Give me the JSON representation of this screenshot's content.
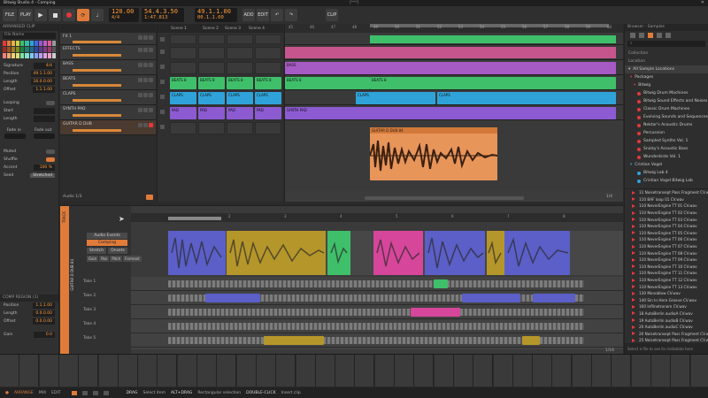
{
  "app_title": "Bitwig Studio 4 - Comping",
  "window_title": "[***]",
  "toolbar": {
    "file": "FILE",
    "play": "PLAY",
    "tempo": "120.00",
    "sig": "4/4",
    "pos1": "54.4.3.50",
    "pos2": "1:47.813",
    "pos3": "49.1.1.00",
    "pos4": "00.1.1.00",
    "add": "ADD",
    "edit": "EDIT",
    "clip": "CLIP"
  },
  "inspector": {
    "title": "ARRANGED CLIP",
    "file": "File Name",
    "rows": [
      {
        "label": "Signature",
        "value": "4/4"
      },
      {
        "label": "Position",
        "value": "49.1.1.00"
      },
      {
        "label": "Length",
        "value": "16.0.0.00"
      },
      {
        "label": "Offset",
        "value": "1.1.1.00"
      }
    ],
    "looping": "Looping",
    "start": "Start",
    "length": "Length",
    "fadein": "Fade in",
    "fadeout": "Fade out",
    "muted": "Muted",
    "shuffle": "Shuffle",
    "accent": "Accent",
    "accent_val": "100 %",
    "seed": "Seed",
    "stretched": "Stretched",
    "comp_title": "COMP REGION (1)",
    "comp_rows": [
      {
        "label": "Position",
        "value": "1.1.1.00"
      },
      {
        "label": "Length",
        "value": "0.0.0.00"
      },
      {
        "label": "Offset",
        "value": "0.0.0.00"
      },
      {
        "label": "Gain",
        "value": "0.0"
      }
    ]
  },
  "tracks": [
    {
      "name": "FX 1",
      "color": "#d66a6a"
    },
    {
      "name": "EFFECTS",
      "color": "#888"
    },
    {
      "name": "BASS",
      "color": "#a65ac4"
    },
    {
      "name": "BEATS",
      "color": "#3fbf6a"
    },
    {
      "name": "CLAPS",
      "color": "#2fa3d9"
    },
    {
      "name": "SYNTH PAD",
      "color": "#8c5ad1"
    },
    {
      "name": "GUITAR D DUB",
      "color": "#e07b3a"
    }
  ],
  "scenes": [
    "Scene 1",
    "Scene 2",
    "Scene 3",
    "Scene 4"
  ],
  "launcher_clips": [
    {
      "row": 3,
      "col": 0,
      "label": "BEATS 8",
      "color": "#3fbf6a"
    },
    {
      "row": 3,
      "col": 1,
      "label": "BEATS 8",
      "color": "#3fbf6a"
    },
    {
      "row": 3,
      "col": 2,
      "label": "BEATS 8",
      "color": "#3fbf6a"
    },
    {
      "row": 3,
      "col": 3,
      "label": "BEATS 8",
      "color": "#3fbf6a"
    },
    {
      "row": 4,
      "col": 0,
      "label": "CLAPS",
      "color": "#2fa3d9"
    },
    {
      "row": 4,
      "col": 1,
      "label": "CLAPS",
      "color": "#2fa3d9"
    },
    {
      "row": 4,
      "col": 2,
      "label": "CLAPS",
      "color": "#2fa3d9"
    },
    {
      "row": 4,
      "col": 3,
      "label": "CLAPS",
      "color": "#2fa3d9"
    },
    {
      "row": 5,
      "col": 0,
      "label": "PAD",
      "color": "#8c5ad1"
    },
    {
      "row": 5,
      "col": 1,
      "label": "PAD",
      "color": "#8c5ad1"
    },
    {
      "row": 5,
      "col": 2,
      "label": "PAD",
      "color": "#8c5ad1"
    },
    {
      "row": 5,
      "col": 3,
      "label": "PAD",
      "color": "#8c5ad1"
    }
  ],
  "ruler": [
    "45",
    "46",
    "47",
    "48",
    "49",
    "50",
    "51",
    "52",
    "53",
    "54",
    "55",
    "56",
    "57",
    "58",
    "59",
    "60",
    "61",
    "62"
  ],
  "arr_labels": {
    "bass": "BASS",
    "beats": "BEATS 8",
    "claps": "CLAPS",
    "pad": "SYNTH PAD",
    "guitar": "GUITAR D DUB 84"
  },
  "audio_label": "Audio 1/3",
  "zoom": "1/4",
  "browser": {
    "title": "Browser - Samples",
    "collection": "Collection",
    "location": "Location",
    "all": "All Sample Locations",
    "packages": "Packages",
    "bitwig": "Bitwig",
    "items": [
      "Bitwig Drum Machines",
      "Bitwig Sound Effects and Noises",
      "Classic Drum Machines",
      "Evolving Sounds and Sequences",
      "Nektar's Acoustic Drums",
      "Percussion",
      "Sampled Synths Vol. 1",
      "Snicky's Acoustic Bass",
      "Wunderkiste Vol. 1"
    ],
    "user": "Cristian Vogel",
    "user_items": [
      "Bitwig Lab 4",
      "Cristian Vogel Bitwig Lab"
    ],
    "files": [
      "11 Noisetransept Pass Fragment CV.wav",
      "110 BAF loop 01 CV.wav",
      "110 NeverEngine TT 01 CV.wav",
      "110 NeverEngine TT 02 CV.wav",
      "110 NeverEngine TT 03 CV.wav",
      "110 NeverEngine TT 04 CV.wav",
      "110 NeverEngine TT 05 CV.wav",
      "110 NeverEngine TT 06 CV.wav",
      "110 NeverEngine TT 07 CV.wav",
      "110 NeverEngine TT 08 CV.wav",
      "110 NeverEngine TT 09 CV.wav",
      "110 NeverEngine TT 10 CV.wav",
      "110 NeverEngine TT 11 CV.wav",
      "110 NeverEngine TT 12 CV.wav",
      "110 NeverEngine TT 13 CV.wav",
      "130 Monoblow CV.wav",
      "140 Sin In Here Groove CV.wav",
      "160 Inflinetronom CV.wav",
      "18 AutoBerlin audioA CV.wav",
      "19 AutoBerlin audioB CV.wav",
      "20 AutoBerlin audioC CV.wav",
      "20 Noisetransept Pass Fragment CV.wav",
      "25 Noisetransept Pass Fragment CV.wav",
      "300 Wonky Machine FX.wav"
    ],
    "footer": "Select a file to see its metadata here"
  },
  "comp": {
    "track": "GUITAR D DUB 84",
    "audio_events": "Audio Events",
    "comping": "Comping",
    "stretch": "Stretch",
    "onsets": "Onsets",
    "gain": "Gain",
    "pan": "Pan",
    "pitch": "Pitch",
    "formant": "Formant",
    "takes": [
      "Take 1",
      "Take 2",
      "Take 3",
      "Take 4",
      "Take 5"
    ],
    "ruler": [
      "2",
      "3",
      "4",
      "5",
      "6",
      "7",
      "8"
    ],
    "zoom": "1/16"
  },
  "statusbar": {
    "arrange": "ARRANGE",
    "mix": "MIX",
    "edit": "EDIT",
    "drag": "DRAG",
    "drag_hint": "Select item",
    "alt": "ALT+DRAG",
    "alt_hint": "Rectangular selection",
    "dbl": "DOUBLE-CLICK",
    "dbl_hint": "Insert clip"
  }
}
